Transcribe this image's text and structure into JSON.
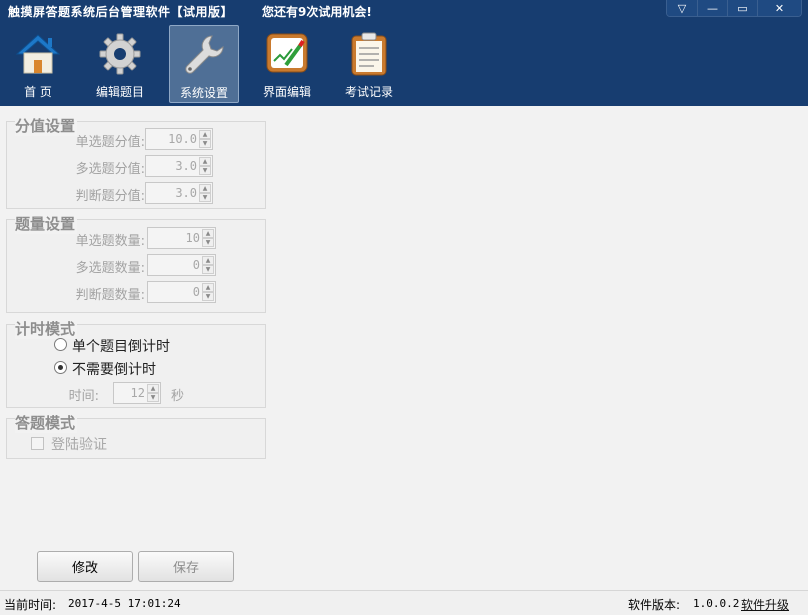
{
  "window": {
    "title": "触摸屏答题系统后台管理软件【试用版】",
    "trial_message": "您还有9次试用机会!",
    "controls": {
      "menu": "▽",
      "minimize": "—",
      "maximize": "▭",
      "close": "✕"
    }
  },
  "toolbar": {
    "items": [
      {
        "label": "首  页",
        "icon": "home-icon"
      },
      {
        "label": "编辑题目",
        "icon": "gear-icon"
      },
      {
        "label": "系统设置",
        "icon": "wrench-icon",
        "active": true
      },
      {
        "label": "界面编辑",
        "icon": "edit-board-icon"
      },
      {
        "label": "考试记录",
        "icon": "clipboard-icon"
      }
    ]
  },
  "score_settings": {
    "title": "分值设置",
    "single": {
      "label": "单选题分值:",
      "value": "10.0"
    },
    "multi": {
      "label": "多选题分值:",
      "value": "3.0"
    },
    "judge": {
      "label": "判断题分值:",
      "value": "3.0"
    }
  },
  "quantity_settings": {
    "title": "题量设置",
    "single": {
      "label": "单选题数量:",
      "value": "10"
    },
    "multi": {
      "label": "多选题数量:",
      "value": "0"
    },
    "judge": {
      "label": "判断题数量:",
      "value": "0"
    }
  },
  "timer_mode": {
    "title": "计时模式",
    "option_per_question": "单个题目倒计时",
    "option_none": "不需要倒计时",
    "selected": "none",
    "time_label": "时间:",
    "time_value": "12",
    "time_unit": "秒"
  },
  "answer_mode": {
    "title": "答题模式",
    "login_verify": "登陆验证",
    "login_verify_checked": false
  },
  "buttons": {
    "modify": "修改",
    "save": "保存"
  },
  "status": {
    "time_label": "当前时间:",
    "time_value": "2017-4-5 17:01:24",
    "version_label": "软件版本:",
    "version_value": "1.0.0.2",
    "upgrade_link": "软件升级"
  },
  "colors": {
    "header_bg": "#173d70",
    "active_tool_bg": "#4f6f96",
    "body_bg": "#f2f2f2"
  }
}
